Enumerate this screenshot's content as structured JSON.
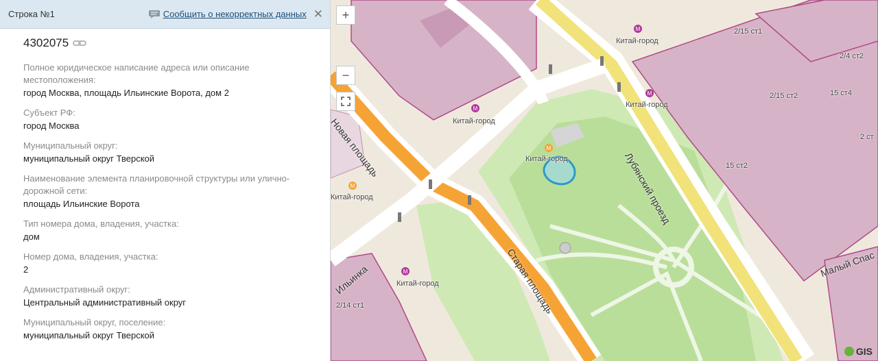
{
  "panel": {
    "title": "Строка №1",
    "report_link": "Сообщить о некорректных данных",
    "close_symbol": "✕",
    "record_id": "4302075",
    "fields": [
      {
        "label": "Полное юридическое написание адреса или описание местоположения:",
        "value": "город Москва, площадь Ильинские Ворота, дом 2"
      },
      {
        "label": "Субъект РФ:",
        "value": "город Москва"
      },
      {
        "label": "Муниципальный округ:",
        "value": "муниципальный округ Тверской"
      },
      {
        "label": "Наименование элемента планировочной структуры или улично-дорожной сети:",
        "value": "площадь Ильинские Ворота"
      },
      {
        "label": "Тип номера дома, владения, участка:",
        "value": "дом"
      },
      {
        "label": "Номер дома, владения, участка:",
        "value": "2"
      },
      {
        "label": "Административный округ:",
        "value": "Центральный административный округ"
      },
      {
        "label": "Муниципальный округ, поселение:",
        "value": "муниципальный округ Тверской"
      }
    ]
  },
  "map": {
    "zoom_in": "+",
    "zoom_out": "−",
    "metro_labels": [
      "Китай-город",
      "Китай-город",
      "Китай-город",
      "Китай-город",
      "Китай-город",
      "Китай-город"
    ],
    "building_labels": [
      "2/15 ст1",
      "2/4 ст2",
      "2/15 ст2",
      "15 ст4",
      "2 ст",
      "15 ст2",
      "2/14 ст1"
    ],
    "streets": [
      "Новая площадь",
      "Лубянский проезд",
      "Старая площадь",
      "Ильинка",
      "Малый Спас"
    ],
    "logo": "GIS",
    "colors": {
      "building": "#d7b3c8",
      "road_major": "#f6a336",
      "road_yellow": "#f2e27a",
      "park": "#b9de9a",
      "metro": "#b0399a",
      "highlight": "#2a9ac4"
    }
  }
}
